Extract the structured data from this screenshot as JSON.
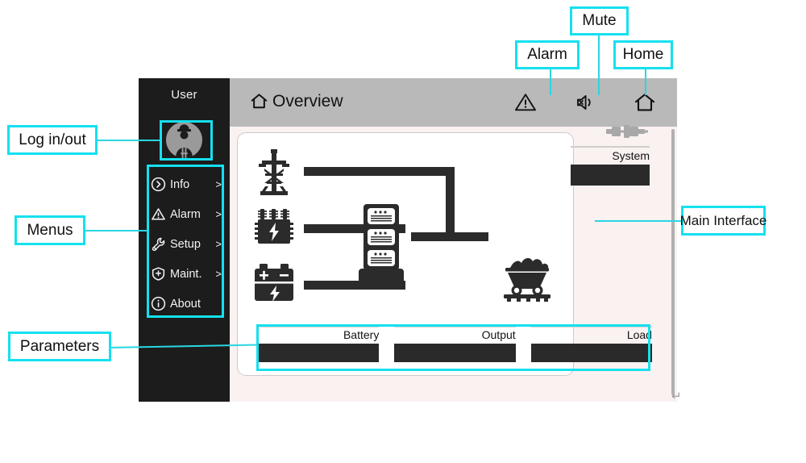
{
  "device": {
    "sidebar": {
      "user_label": "User",
      "avatar_icon": "worker-avatar-icon",
      "items": [
        {
          "label": "Info",
          "icon": "circle-chevron-right-icon",
          "arrow": ">"
        },
        {
          "label": "Alarm",
          "icon": "warning-triangle-icon",
          "arrow": ">"
        },
        {
          "label": "Setup",
          "icon": "wrench-icon",
          "arrow": ">"
        },
        {
          "label": "Maint.",
          "icon": "shield-plus-icon",
          "arrow": ">"
        },
        {
          "label": "About",
          "icon": "info-circle-icon",
          "arrow": ""
        }
      ]
    },
    "header": {
      "title": "Overview",
      "title_icon": "home-icon",
      "icons": [
        {
          "name": "alarm-warning-icon"
        },
        {
          "name": "mute-speaker-icon"
        },
        {
          "name": "home-icon"
        }
      ]
    },
    "main": {
      "plug_icon": "plug-connector-icon",
      "system": {
        "label": "System",
        "value": ""
      },
      "diagram": {
        "sources": [
          {
            "icon": "power-tower-icon"
          },
          {
            "icon": "transformer-icon"
          },
          {
            "icon": "battery-icon"
          }
        ],
        "converter_icon": "rack-cabinet-icon",
        "load_icon": "mine-cart-icon"
      },
      "parameters": [
        {
          "label": "Battery",
          "value": ""
        },
        {
          "label": "Output",
          "value": ""
        },
        {
          "label": "Load",
          "value": ""
        }
      ]
    },
    "enter_mark": "↵"
  },
  "annotations": {
    "accent_color": "#15e0ef",
    "callouts": [
      {
        "id": "alarm",
        "label": "Alarm"
      },
      {
        "id": "mute",
        "label": "Mute"
      },
      {
        "id": "home",
        "label": "Home"
      },
      {
        "id": "log-in-out",
        "label": "Log in/out"
      },
      {
        "id": "menus",
        "label": "Menus"
      },
      {
        "id": "parameters",
        "label": "Parameters"
      },
      {
        "id": "main-interface",
        "label": "Main Interface"
      }
    ]
  }
}
